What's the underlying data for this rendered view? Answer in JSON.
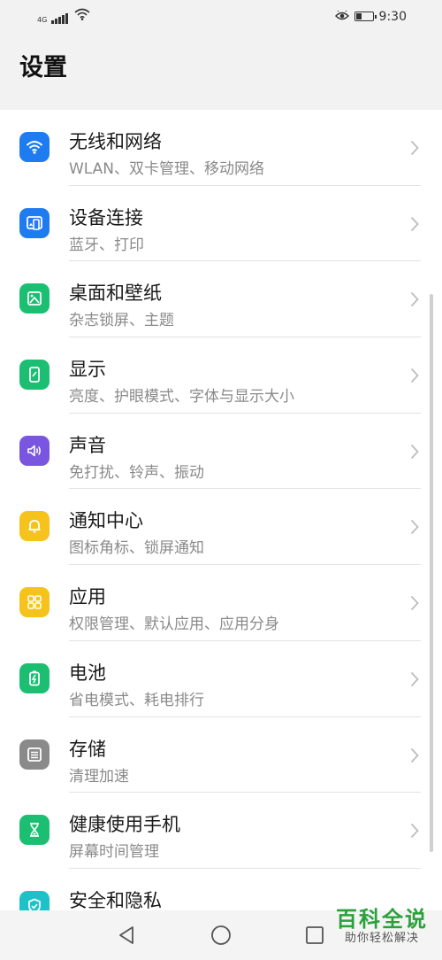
{
  "status_bar": {
    "network": "4G",
    "time": "9:30",
    "battery_level": 0.3,
    "icons": [
      "signal-icon",
      "wifi-icon",
      "eye-comfort-icon",
      "battery-icon"
    ]
  },
  "header": {
    "title": "设置"
  },
  "items": [
    {
      "label": "无线和网络",
      "sub": "WLAN、双卡管理、移动网络",
      "icon": "wifi-icon",
      "color": "#1e7cf0"
    },
    {
      "label": "设备连接",
      "sub": "蓝牙、打印",
      "icon": "device-connect-icon",
      "color": "#1e7cf0"
    },
    {
      "label": "桌面和壁纸",
      "sub": "杂志锁屏、主题",
      "icon": "wallpaper-icon",
      "color": "#1cbf72"
    },
    {
      "label": "显示",
      "sub": "亮度、护眼模式、字体与显示大小",
      "icon": "display-icon",
      "color": "#1cbf72"
    },
    {
      "label": "声音",
      "sub": "免打扰、铃声、振动",
      "icon": "sound-icon",
      "color": "#7a55e0"
    },
    {
      "label": "通知中心",
      "sub": "图标角标、锁屏通知",
      "icon": "bell-icon",
      "color": "#f6c21c"
    },
    {
      "label": "应用",
      "sub": "权限管理、默认应用、应用分身",
      "icon": "apps-icon",
      "color": "#f6c21c"
    },
    {
      "label": "电池",
      "sub": "省电模式、耗电排行",
      "icon": "battery-icon",
      "color": "#1cbf72"
    },
    {
      "label": "存储",
      "sub": "清理加速",
      "icon": "storage-icon",
      "color": "#8a8a8a"
    },
    {
      "label": "健康使用手机",
      "sub": "屏幕时间管理",
      "icon": "hourglass-icon",
      "color": "#1cbf72"
    },
    {
      "label": "安全和隐私",
      "sub": "",
      "icon": "shield-icon",
      "color": "#1cc2c8"
    }
  ],
  "nav": {
    "icons": [
      "back-icon",
      "home-icon",
      "recents-icon"
    ]
  },
  "watermark": {
    "title": "百科全说",
    "subtitle": "助你轻松解决"
  }
}
